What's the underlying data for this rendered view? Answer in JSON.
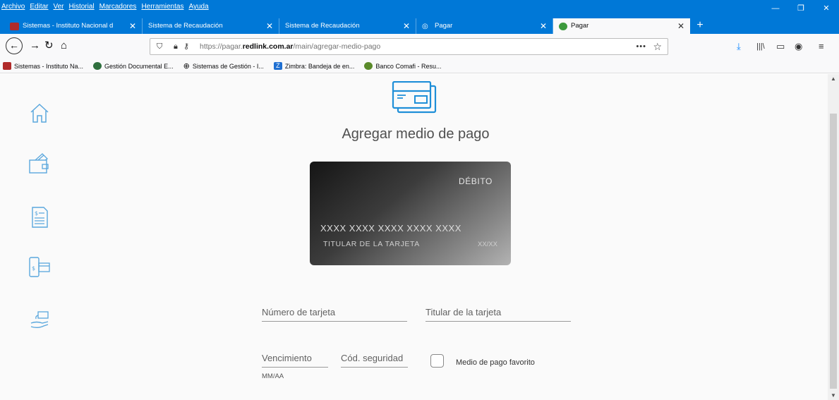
{
  "browser": {
    "menu": [
      "Archivo",
      "Editar",
      "Ver",
      "Historial",
      "Marcadores",
      "Herramientas",
      "Ayuda"
    ],
    "tabs": [
      {
        "label": "Sistemas - Instituto Nacional d",
        "favicon_color": "#b02a2a"
      },
      {
        "label": "Sistema de Recaudación"
      },
      {
        "label": "Sistema de Recaudación"
      },
      {
        "label": "Pagar",
        "favicon": "globe-icon"
      },
      {
        "label": "Pagar",
        "favicon_color": "#3d9a3d",
        "active": true
      }
    ],
    "url": {
      "prefix": "https://pagar.",
      "domain": "redlink.com.ar",
      "path": "/main/agregar-medio-pago"
    },
    "bookmarks": [
      {
        "label": "Sistemas - Instituto Na...",
        "favicon_color": "#b02a2a"
      },
      {
        "label": "Gestión Documental E...",
        "favicon_color": "#2f6f3e"
      },
      {
        "label": "Sistemas de Gestión - I...",
        "favicon": "globe-icon"
      },
      {
        "label": "Zimbra: Bandeja de en...",
        "favicon_color": "#1f6fd1"
      },
      {
        "label": "Banco Comafi - Resu...",
        "favicon_color": "#5a8a2a"
      }
    ]
  },
  "page": {
    "title": "Agregar medio de pago",
    "card": {
      "type": "DÉBITO",
      "number": "XXXX XXXX XXXX XXXX XXXX",
      "holder": "TITULAR DE LA TARJETA",
      "expiry": "XX/XX"
    },
    "form": {
      "card_number_placeholder": "Número de tarjeta",
      "holder_placeholder": "Titular de la tarjeta",
      "expiry_placeholder": "Vencimiento",
      "expiry_hint": "MM/AA",
      "cvv_placeholder": "Cód. seguridad",
      "favorite_label": "Medio de pago favorito"
    },
    "accent_color": "#1f8fd8"
  }
}
